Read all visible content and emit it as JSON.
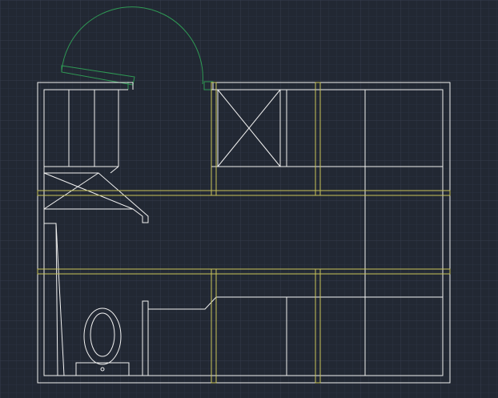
{
  "app": {
    "view": "cad-model-space",
    "background_color": "#222833",
    "grid_minor_color": "#2b3240",
    "grid_major_color": "#353d4d"
  },
  "layers": {
    "walls": {
      "color": "#f2f2f2"
    },
    "beams": {
      "color": "#c9c35a"
    },
    "door_swing": {
      "color": "#2f9a55"
    }
  }
}
